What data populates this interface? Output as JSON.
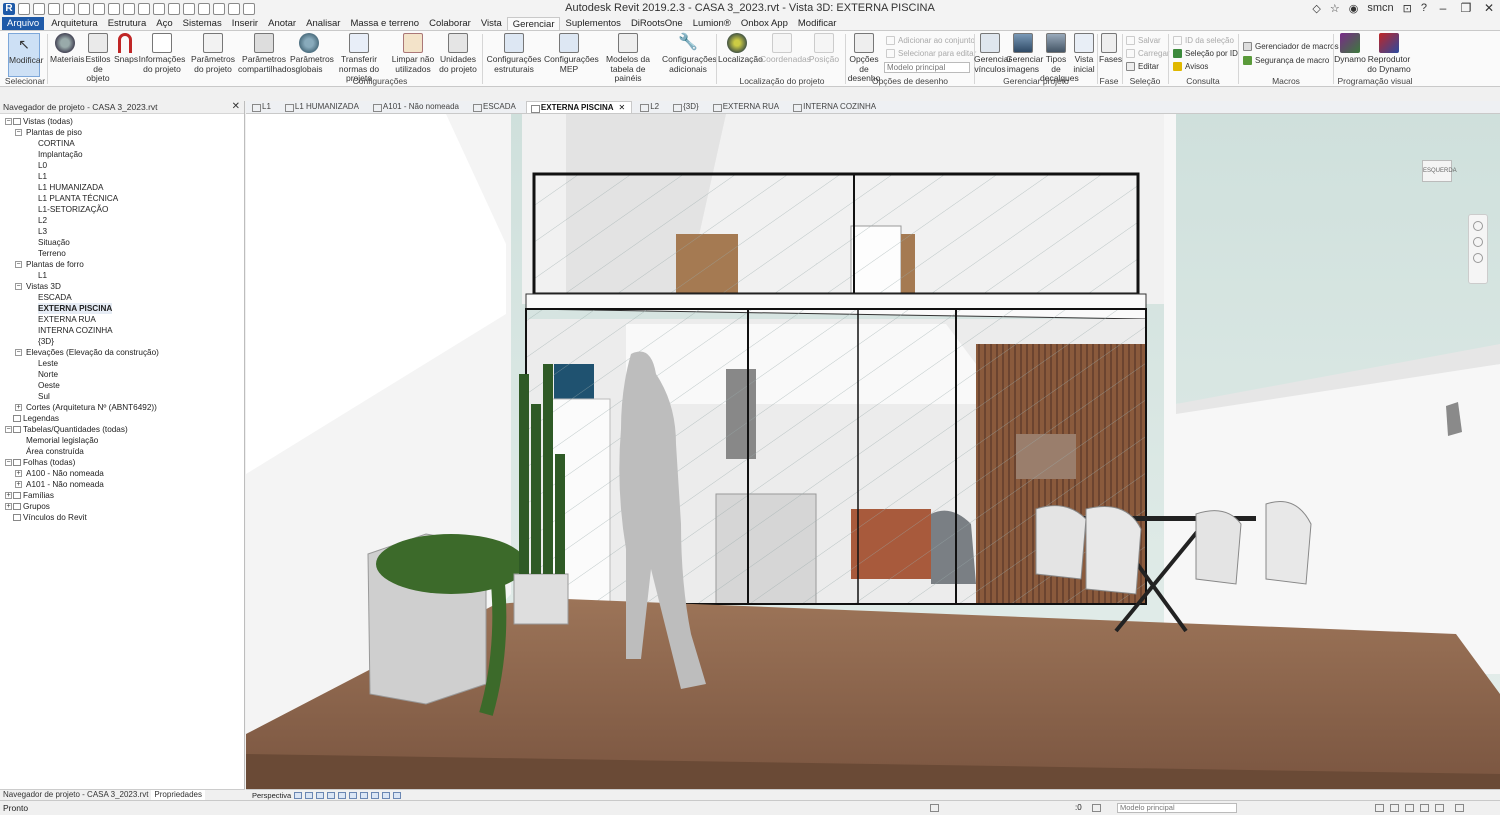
{
  "window": {
    "title": "Autodesk Revit 2019.2.3 - CASA 3_2023.rvt - Vista 3D: EXTERNA PISCINA",
    "user": "smcn",
    "controls": [
      "–",
      "❐",
      "✕"
    ]
  },
  "ribbon_tabs": [
    "Arquivo",
    "Arquitetura",
    "Estrutura",
    "Aço",
    "Sistemas",
    "Inserir",
    "Anotar",
    "Analisar",
    "Massa e terreno",
    "Colaborar",
    "Vista",
    "Gerenciar",
    "Suplementos",
    "DiRootsOne",
    "Lumion®",
    "Onbox App",
    "Modificar"
  ],
  "ribbon": {
    "selecionar": "Selecionar",
    "modificar": "Modificar",
    "buttons": {
      "materiais": "Materiais",
      "estilos_objeto": "Estilos de objeto",
      "snaps": "Snaps",
      "informacoes_projeto": "Informações do projeto",
      "parametros_projeto": "Parâmetros do projeto",
      "parametros_compartilhados": "Parâmetros compartilhados",
      "parametros_globais": "Parâmetros globais",
      "transferir_normas": "Transferir normas do projeto",
      "limpar": "Limpar não utilizados",
      "unidades": "Unidades do projeto",
      "config_estruturais": "Configurações estruturais",
      "config_mep": "Configurações MEP",
      "modelos_tabela": "Modelos da tabela de painéis",
      "config_adicionais": "Configurações adicionais",
      "localizacao": "Localização",
      "coordenadas": "Coordenadas",
      "posicao": "Posição",
      "opcoes_desenho": "Opções de desenho",
      "gerenciar_vinculos": "Gerenciar vínculos",
      "gerenciar_imagens": "Gerenciar imagens",
      "tipos_decalques": "Tipos de decalques",
      "vista_inicial": "Vista inicial",
      "fases": "Fases",
      "dynamo": "Dynamo",
      "reprodutor_dynamo": "Reprodutor do Dynamo"
    },
    "small": {
      "adicionar_conjunto": "Adicionar ao conjunto",
      "selecionar_editar": "Selecionar para editar",
      "modelo_principal": "Modelo principal",
      "salvar": "Salvar",
      "carregar": "Carregar",
      "editar": "Editar",
      "id_selecao": "ID da seleção",
      "selecao_por_id": "Seleção por ID",
      "avisos": "Avisos",
      "gerenciador_macros": "Gerenciador de macros",
      "seguranca_macro": "Segurança de macro"
    },
    "groups": {
      "selecionar": "Selecionar",
      "configuracoes": "Configurações",
      "localizacao_projeto": "Localização do projeto",
      "opcoes_desenho": "Opções de desenho",
      "gerenciar_projeto": "Gerenciar projeto",
      "fase": "Fase",
      "selecao": "Seleção",
      "consulta": "Consulta",
      "macros": "Macros",
      "programacao_visual": "Programação visual"
    }
  },
  "browser": {
    "header": "Navegador de projeto - CASA 3_2023.rvt",
    "close": "✕",
    "tree": [
      {
        "label": "Vistas (todas)",
        "level": 0,
        "toggle": "−",
        "icon": true
      },
      {
        "label": "Plantas de piso",
        "level": 1,
        "toggle": "−"
      },
      {
        "label": "CORTINA",
        "level": 2
      },
      {
        "label": "Implantação",
        "level": 2
      },
      {
        "label": "L0",
        "level": 2
      },
      {
        "label": "L1",
        "level": 2
      },
      {
        "label": "L1 HUMANIZADA",
        "level": 2
      },
      {
        "label": "L1 PLANTA TÉCNICA",
        "level": 2
      },
      {
        "label": "L1-SETORIZAÇÃO",
        "level": 2
      },
      {
        "label": "L2",
        "level": 2
      },
      {
        "label": "L3",
        "level": 2
      },
      {
        "label": "Situação",
        "level": 2
      },
      {
        "label": "Terreno",
        "level": 2
      },
      {
        "label": "Plantas de forro",
        "level": 1,
        "toggle": "−"
      },
      {
        "label": "L1",
        "level": 2
      },
      {
        "label": "Vistas 3D",
        "level": 1,
        "toggle": "−"
      },
      {
        "label": "ESCADA",
        "level": 2
      },
      {
        "label": "EXTERNA PISCINA",
        "level": 2,
        "bold": true
      },
      {
        "label": "EXTERNA RUA",
        "level": 2
      },
      {
        "label": "INTERNA COZINHA",
        "level": 2
      },
      {
        "label": "{3D}",
        "level": 2
      },
      {
        "label": "Elevações (Elevação da construção)",
        "level": 1,
        "toggle": "−"
      },
      {
        "label": "Leste",
        "level": 2
      },
      {
        "label": "Norte",
        "level": 2
      },
      {
        "label": "Oeste",
        "level": 2
      },
      {
        "label": "Sul",
        "level": 2
      },
      {
        "label": "Cortes (Arquitetura Nº (ABNT6492))",
        "level": 1,
        "toggle": "+"
      },
      {
        "label": "Legendas",
        "level": 0,
        "icon": true
      },
      {
        "label": "Tabelas/Quantidades (todas)",
        "level": 0,
        "toggle": "−",
        "icon": true
      },
      {
        "label": "Memorial legislação",
        "level": 1
      },
      {
        "label": "Área construída",
        "level": 1
      },
      {
        "label": "Folhas (todas)",
        "level": 0,
        "toggle": "−",
        "icon": true
      },
      {
        "label": "A100 - Não nomeada",
        "level": 1,
        "toggle": "+"
      },
      {
        "label": "A101 - Não nomeada",
        "level": 1,
        "toggle": "+"
      },
      {
        "label": "Famílias",
        "level": 0,
        "toggle": "+",
        "icon": true
      },
      {
        "label": "Grupos",
        "level": 0,
        "toggle": "+",
        "icon": true
      },
      {
        "label": "Vínculos do Revit",
        "level": 0,
        "icon": true
      }
    ],
    "footer_tabs": [
      "Navegador de projeto - CASA 3_2023.rvt",
      "Propriedades"
    ]
  },
  "view_tabs": [
    {
      "label": "L1"
    },
    {
      "label": "L1 HUMANIZADA"
    },
    {
      "label": "A101 - Não nomeada"
    },
    {
      "label": "ESCADA"
    },
    {
      "label": "EXTERNA PISCINA",
      "active": true
    },
    {
      "label": "L2"
    },
    {
      "label": "{3D}"
    },
    {
      "label": "EXTERNA RUA"
    },
    {
      "label": "INTERNA COZINHA"
    }
  ],
  "canvas": {
    "viewcube": "ESQUERDA"
  },
  "viewbar": {
    "mode": "Perspectiva"
  },
  "status": {
    "text": "Pronto",
    "coord": ":0",
    "model": "Modelo principal"
  }
}
